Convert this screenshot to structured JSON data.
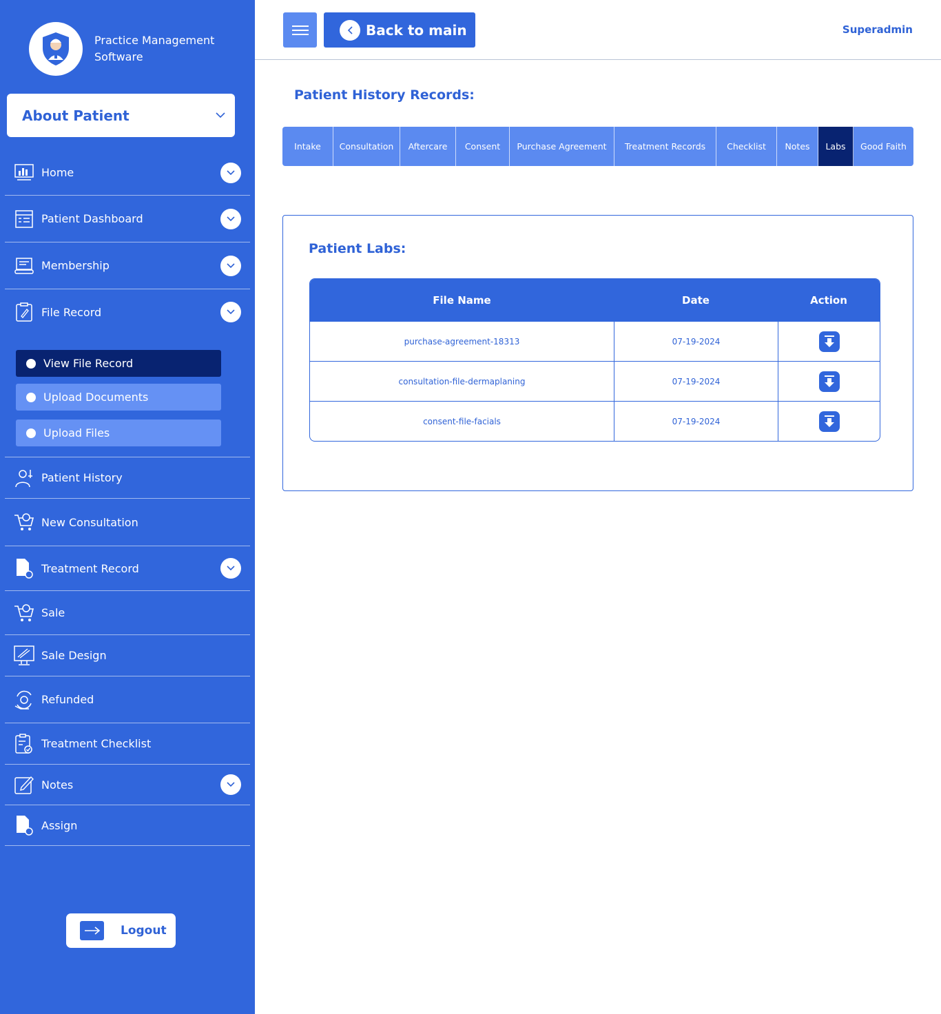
{
  "app": {
    "title": "Practice Management Software"
  },
  "sidebar": {
    "about_label": "About Patient",
    "nav": [
      {
        "label": "Home",
        "icon": "chart-icon"
      },
      {
        "label": "Patient Dashboard",
        "icon": "dashboard-icon"
      },
      {
        "label": "Membership",
        "icon": "membership-icon"
      },
      {
        "label": "File Record",
        "icon": "clipboard-icon"
      },
      {
        "label": "Patient History",
        "icon": "doctor-icon"
      },
      {
        "label": "New Consultation",
        "icon": "cart-icon"
      },
      {
        "label": "Treatment Record",
        "icon": "document-icon"
      },
      {
        "label": "Sale",
        "icon": "cart-icon"
      },
      {
        "label": "Sale Design",
        "icon": "monitor-icon"
      },
      {
        "label": "Refunded",
        "icon": "refund-icon"
      },
      {
        "label": "Treatment Checklist",
        "icon": "checklist-icon"
      },
      {
        "label": "Notes",
        "icon": "edit-icon"
      },
      {
        "label": "Assign",
        "icon": "document-icon"
      }
    ],
    "sub_items": [
      {
        "label": "View File Record"
      },
      {
        "label": "Upload Documents"
      },
      {
        "label": "Upload Files"
      }
    ],
    "logout_label": "Logout"
  },
  "header": {
    "back_label": "Back to main",
    "user": "Superadmin"
  },
  "main": {
    "section_title": "Patient History Records:",
    "tabs": [
      {
        "label": "Intake"
      },
      {
        "label": "Consultation"
      },
      {
        "label": "Aftercare"
      },
      {
        "label": "Consent"
      },
      {
        "label": "Purchase Agreement"
      },
      {
        "label": "Treatment Records"
      },
      {
        "label": "Checklist"
      },
      {
        "label": "Notes"
      },
      {
        "label": "Labs"
      },
      {
        "label": "Good Faith"
      }
    ],
    "active_tab": "Labs",
    "panel_title": "Patient Labs:",
    "table": {
      "headers": [
        "File Name",
        "Date",
        "Action"
      ],
      "rows": [
        {
          "file": "purchase-agreement-18313",
          "date": "07-19-2024"
        },
        {
          "file": "consultation-file-dermaplaning",
          "date": "07-19-2024"
        },
        {
          "file": "consent-file-facials",
          "date": "07-19-2024"
        }
      ]
    }
  },
  "colors": {
    "primary": "#3166dc",
    "light": "#5b8af0",
    "dark_active": "#082371",
    "text_blue": "#2f62d6"
  }
}
